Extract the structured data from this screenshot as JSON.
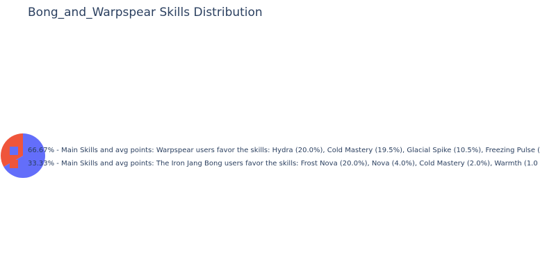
{
  "chart_data": {
    "type": "pie",
    "title": "Bong_and_Warpspear Skills Distribution",
    "slices": [
      {
        "label": "66.67% - Main Skills and avg points: Warpspear users favor the skills: Hydra (20.0%), Cold Mastery (19.5%), Glacial Spike (10.5%), Freezing Pulse (",
        "value": 66.67,
        "color": "#636efa"
      },
      {
        "label": "33.33% - Main Skills and avg points: The Iron Jang Bong users favor the skills: Frost Nova (20.0%), Nova (4.0%), Cold Mastery (2.0%), Warmth (1.0",
        "value": 33.33,
        "color": "#ef553b"
      }
    ],
    "legend_position": "right",
    "slice_text_visible": false
  }
}
